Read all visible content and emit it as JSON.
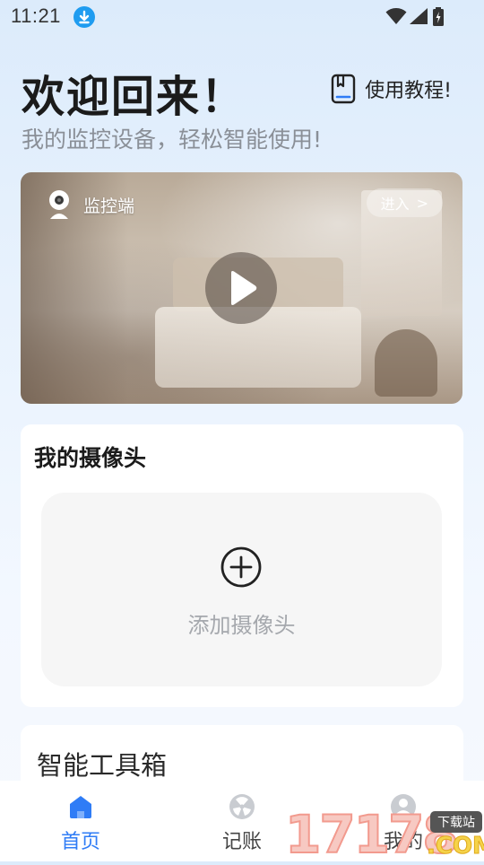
{
  "status_bar": {
    "time": "11:21",
    "icons": [
      "download-icon",
      "wifi-icon",
      "signal-icon",
      "battery-icon"
    ]
  },
  "header": {
    "title": "欢迎回来！",
    "subtitle": "我的监控设备，轻松智能使用!",
    "tutorial_label": "使用教程!"
  },
  "video_card": {
    "label": "监控端",
    "enter_label": "进入",
    "enter_chevron": ">"
  },
  "camera_section": {
    "title": "我的摄像头",
    "add_label": "添加摄像头"
  },
  "toolbox": {
    "title": "智能工具箱"
  },
  "tabs": [
    {
      "label": "首页",
      "icon": "home-icon",
      "active": true
    },
    {
      "label": "记账",
      "icon": "ledger-icon",
      "active": false
    },
    {
      "label": "我的",
      "icon": "profile-icon",
      "active": false
    }
  ],
  "watermark": {
    "digits": "17178",
    "badge": "下载站",
    "suffix": ".COM"
  },
  "colors": {
    "accent": "#2f7cf6",
    "status_download": "#1f9cf0",
    "background_top": "#dcebfb"
  }
}
